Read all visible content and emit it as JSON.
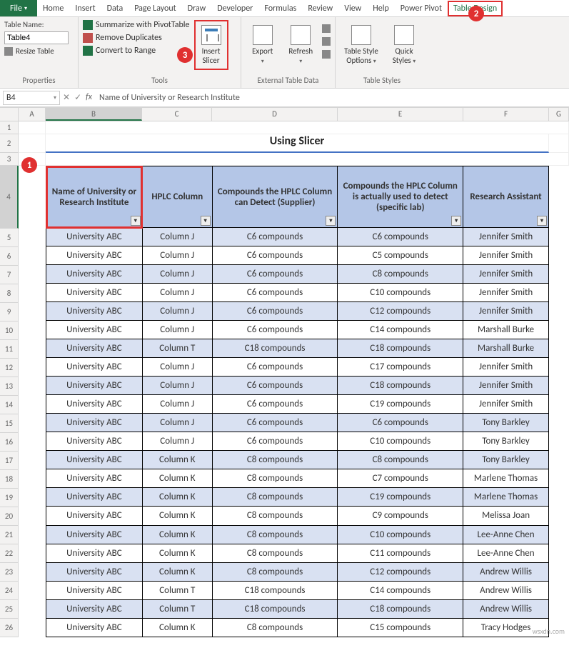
{
  "ribbon": {
    "file": "File",
    "tabs": [
      "Home",
      "Insert",
      "Data",
      "Page Layout",
      "Draw",
      "Developer",
      "Formulas",
      "Review",
      "View",
      "Help",
      "Power Pivot",
      "Table Design"
    ],
    "active_index": 11
  },
  "groups": {
    "properties": {
      "label": "Properties",
      "table_name_label": "Table Name:",
      "table_name_value": "Table4",
      "resize": "Resize Table"
    },
    "tools": {
      "label": "Tools",
      "summarize": "Summarize with PivotTable",
      "remove_dup": "Remove Duplicates",
      "convert": "Convert to Range",
      "insert_slicer": "Insert Slicer"
    },
    "ext": {
      "label": "External Table Data",
      "export": "Export",
      "refresh": "Refresh"
    },
    "styles": {
      "label": "Table Styles",
      "options": "Table Style Options",
      "quick": "Quick Styles"
    }
  },
  "callouts": {
    "c1": "1",
    "c2": "2",
    "c3": "3"
  },
  "formula_bar": {
    "cell_ref": "B4",
    "content": "Name of University or Research Institute"
  },
  "columns": [
    "A",
    "B",
    "C",
    "D",
    "E",
    "F",
    "G"
  ],
  "title": "Using Slicer",
  "table": {
    "headers": [
      "Name of University or Research Institute",
      "HPLC Column",
      "Compounds the HPLC Column can Detect (Supplier)",
      "Compounds the HPLC Column is actually used to detect (specific lab)",
      "Research Assistant"
    ],
    "rows": [
      [
        "University ABC",
        "Column J",
        "C6 compounds",
        "C6 compounds",
        "Jennifer Smith"
      ],
      [
        "University ABC",
        "Column J",
        "C6 compounds",
        "C5 compounds",
        "Jennifer Smith"
      ],
      [
        "University ABC",
        "Column J",
        "C6 compounds",
        "C8 compounds",
        "Jennifer Smith"
      ],
      [
        "University ABC",
        "Column J",
        "C6 compounds",
        "C10 compounds",
        "Jennifer Smith"
      ],
      [
        "University ABC",
        "Column J",
        "C6 compounds",
        "C12 compounds",
        "Jennifer Smith"
      ],
      [
        "University ABC",
        "Column J",
        "C6 compounds",
        "C14 compounds",
        "Marshall Burke"
      ],
      [
        "University ABC",
        "Column T",
        "C18 compounds",
        "C18 compounds",
        "Marshall Burke"
      ],
      [
        "University ABC",
        "Column J",
        "C6 compounds",
        "C17 compounds",
        "Jennifer Smith"
      ],
      [
        "University ABC",
        "Column J",
        "C6 compounds",
        "C18 compounds",
        "Jennifer Smith"
      ],
      [
        "University ABC",
        "Column J",
        "C6 compounds",
        "C19 compounds",
        "Jennifer Smith"
      ],
      [
        "University ABC",
        "Column J",
        "C6 compounds",
        "C6 compounds",
        "Tony Barkley"
      ],
      [
        "University ABC",
        "Column J",
        "C6 compounds",
        "C10 compounds",
        "Tony Barkley"
      ],
      [
        "University ABC",
        "Column K",
        "C8 compounds",
        "C8 compounds",
        "Tony Barkley"
      ],
      [
        "University ABC",
        "Column K",
        "C8 compounds",
        "C7 compounds",
        "Marlene Thomas"
      ],
      [
        "University ABC",
        "Column K",
        "C8 compounds",
        "C19 compounds",
        "Marlene Thomas"
      ],
      [
        "University ABC",
        "Column K",
        "C8 compounds",
        "C9 compounds",
        "Melissa Joan"
      ],
      [
        "University ABC",
        "Column K",
        "C8 compounds",
        "C10 compounds",
        "Lee-Anne Chen"
      ],
      [
        "University ABC",
        "Column K",
        "C8 compounds",
        "C11 compounds",
        "Lee-Anne Chen"
      ],
      [
        "University ABC",
        "Column K",
        "C8 compounds",
        "C12 compounds",
        "Andrew Willis"
      ],
      [
        "University ABC",
        "Column T",
        "C18 compounds",
        "C14 compounds",
        "Andrew Willis"
      ],
      [
        "University ABC",
        "Column T",
        "C18 compounds",
        "C18 compounds",
        "Andrew Willis"
      ],
      [
        "University ABC",
        "Column K",
        "C8 compounds",
        "C15 compounds",
        "Tracy Hodges"
      ]
    ]
  },
  "watermark": "wsxdn.com"
}
